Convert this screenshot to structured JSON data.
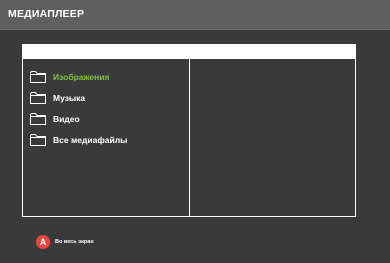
{
  "header": {
    "title": "МЕДИАПЛЕЕР"
  },
  "path_bar": {
    "value": ""
  },
  "folders": [
    {
      "label": "Изображения",
      "icon": "folder-icon",
      "selected": true
    },
    {
      "label": "Музыка",
      "icon": "folder-icon",
      "selected": false
    },
    {
      "label": "Видео",
      "icon": "folder-icon",
      "selected": false
    },
    {
      "label": "Все медиафайлы",
      "icon": "folder-icon",
      "selected": false
    }
  ],
  "footer": {
    "button_key": "A",
    "button_label": "Во весь экран"
  },
  "colors": {
    "background": "#3a3a3a",
    "title_bar": "#5f5f5f",
    "selected_text": "#7cc243",
    "button_a": "#e8453c"
  }
}
